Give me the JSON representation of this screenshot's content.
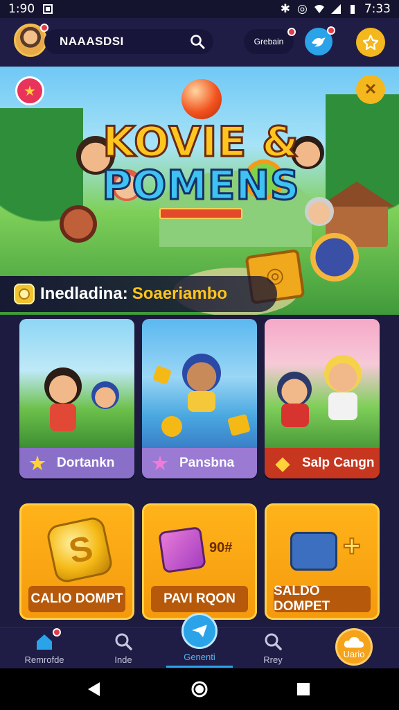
{
  "status_bar": {
    "time_left": "1:90",
    "time_right": "7:33"
  },
  "header": {
    "search_text": "NAAASDSI",
    "pill_label": "Grebain"
  },
  "hero": {
    "title_line1": "KOVIE &",
    "title_line2": "POMENS",
    "featured_label": "Inedladina:",
    "featured_value": "Soaeriambo"
  },
  "games": [
    {
      "label": "Dortankn",
      "foot_color": "#8a6fc9"
    },
    {
      "label": "Pansbna",
      "foot_color": "#9a7ad2"
    },
    {
      "label": "Salp Cangn",
      "foot_color": "#c7361f"
    }
  ],
  "rewards": [
    {
      "label": "CALIO DOMPT"
    },
    {
      "label": "PAVI RQON",
      "badge_text": "90#"
    },
    {
      "label": "SALDO DOMPET"
    }
  ],
  "bottom_nav": {
    "items": [
      {
        "label": "Remrofde"
      },
      {
        "label": "Inde"
      },
      {
        "label": "Genenti"
      },
      {
        "label": "Rrey"
      },
      {
        "label": "Uario"
      }
    ]
  },
  "colors": {
    "accent": "#2aa3e8",
    "gold": "#f4b81e",
    "badge": "#e23b4a",
    "background": "#1d1b40"
  }
}
